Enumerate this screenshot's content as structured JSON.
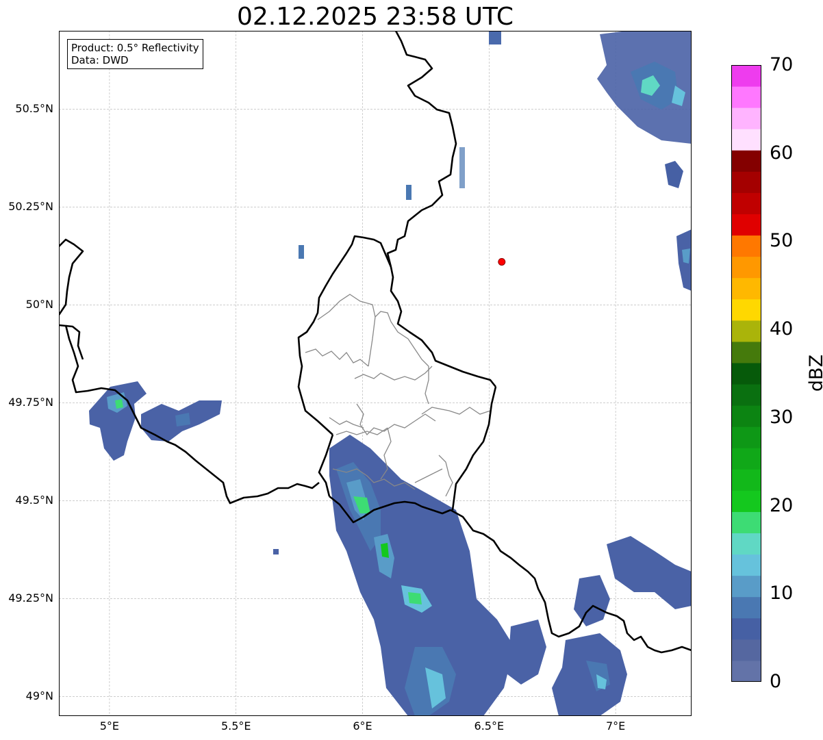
{
  "header": {
    "title": "02.12.2025 23:58 UTC"
  },
  "info_box": {
    "product": "Product: 0.5° Reflectivity",
    "source": "Data: DWD"
  },
  "map": {
    "lon_range": [
      4.8,
      7.3
    ],
    "lat_range": [
      48.95,
      50.7
    ],
    "x_ticks": [
      {
        "value": 5.0,
        "label": "5°E"
      },
      {
        "value": 5.5,
        "label": "5.5°E"
      },
      {
        "value": 6.0,
        "label": "6°E"
      },
      {
        "value": 6.5,
        "label": "6.5°E"
      },
      {
        "value": 7.0,
        "label": "7°E"
      }
    ],
    "y_ticks": [
      {
        "value": 50.5,
        "label": "50.5°N"
      },
      {
        "value": 50.25,
        "label": "50.25°N"
      },
      {
        "value": 50.0,
        "label": "50°N"
      },
      {
        "value": 49.75,
        "label": "49.75°N"
      },
      {
        "value": 49.5,
        "label": "49.5°N"
      },
      {
        "value": 49.25,
        "label": "49.25°N"
      },
      {
        "value": 49.0,
        "label": "49°N"
      }
    ],
    "radar_site": {
      "lon": 6.55,
      "lat": 50.11,
      "color": "#ff0000"
    },
    "colors": {
      "border": "#000000",
      "admin_border": "#888888",
      "gridline": "#b0b0b0"
    }
  },
  "colorbar": {
    "label": "dBZ",
    "ticks": [
      "0",
      "10",
      "20",
      "30",
      "40",
      "50",
      "60",
      "70"
    ],
    "min": 0,
    "max": 70,
    "step": 2.5,
    "colors": [
      "#6373a8",
      "#5567a0",
      "#4660a4",
      "#4a78b2",
      "#599cc8",
      "#66c2dc",
      "#60d8c4",
      "#3ddc74",
      "#14c81e",
      "#12b81a",
      "#10a818",
      "#0e9816",
      "#0c8412",
      "#0a7010",
      "#065a0a",
      "#457a0c",
      "#aab40a",
      "#ffd800",
      "#ffb800",
      "#ff9800",
      "#ff7800",
      "#e00000",
      "#c00000",
      "#a40000",
      "#840000",
      "#ffe0ff",
      "#ffb4ff",
      "#ff78ff",
      "#ee3cee"
    ]
  }
}
